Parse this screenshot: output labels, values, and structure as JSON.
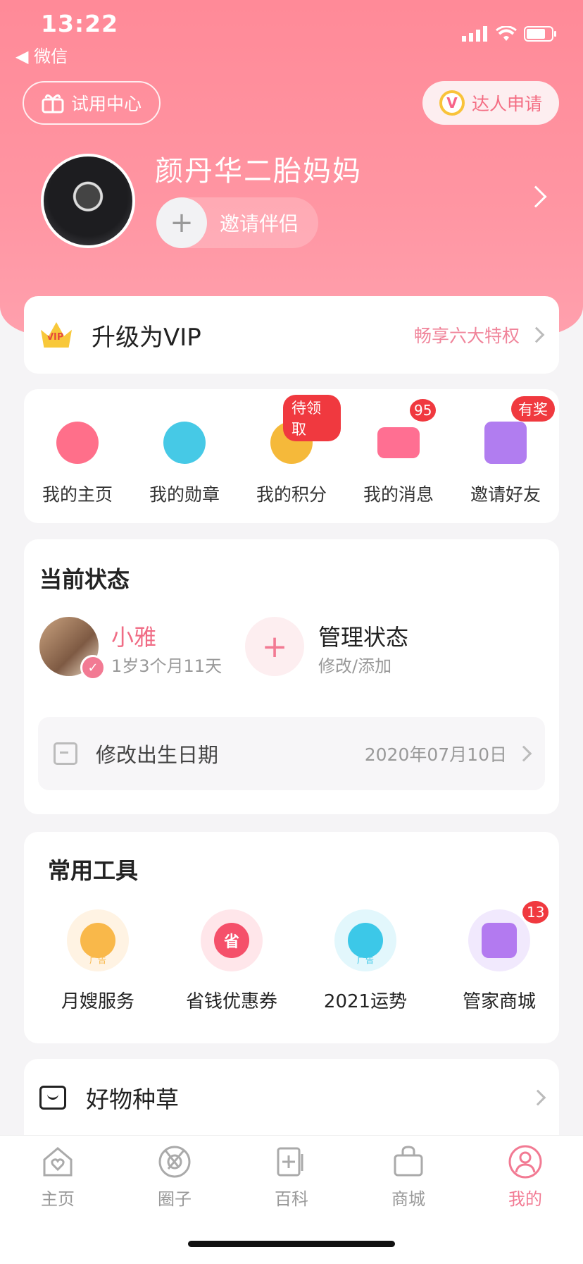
{
  "status_bar": {
    "time": "13:22",
    "back_app": "◀ 微信"
  },
  "header": {
    "trial_label": "试用中心",
    "talent_badge": "V",
    "talent_label": "达人申请",
    "username": "颜丹华二胎妈妈",
    "invite_label": "邀请伴侣",
    "invite_plus": "+"
  },
  "vip": {
    "crown_text": "VIP",
    "title": "升级为VIP",
    "right_text": "畅享六大特权"
  },
  "quick": [
    {
      "label": "我的主页",
      "color": "#ff6f8a",
      "badge": ""
    },
    {
      "label": "我的勋章",
      "color": "#46c9e6",
      "badge": ""
    },
    {
      "label": "我的积分",
      "color": "#f5b93a",
      "badge": "待领取"
    },
    {
      "label": "我的消息",
      "color": "#ff6f92",
      "badge": "95"
    },
    {
      "label": "邀请好友",
      "color": "#b17df0",
      "badge": "有奖"
    }
  ],
  "state": {
    "title": "当前状态",
    "kid_name": "小雅",
    "kid_age": "1岁3个月11天",
    "check": "✓",
    "manage_plus": "+",
    "manage_title": "管理状态",
    "manage_sub": "修改/添加",
    "birth_label": "修改出生日期",
    "birth_date": "2020年07月10日"
  },
  "tools": {
    "title": "常用工具",
    "items": [
      {
        "label": "月嫂服务",
        "core": "",
        "ad": "广告",
        "ring": "#fff3e3",
        "core_color": "#f9b84a",
        "badge": ""
      },
      {
        "label": "省钱优惠券",
        "core": "省",
        "ad": "",
        "ring": "#ffe6ea",
        "core_color": "#f5506a",
        "badge": ""
      },
      {
        "label": "2021运势",
        "core": "",
        "ad": "广告",
        "ring": "#e2f7fc",
        "core_color": "#3cc8e8",
        "badge": ""
      },
      {
        "label": "管家商城",
        "core": "",
        "ad": "",
        "ring": "#f1e9fd",
        "core_color": "#b37af0",
        "badge": "13"
      }
    ]
  },
  "seed": {
    "title": "好物种草"
  },
  "tabbar": [
    {
      "label": "主页",
      "icon": "home-heart-icon",
      "active": false
    },
    {
      "label": "圈子",
      "icon": "circle-aperture-icon",
      "active": false
    },
    {
      "label": "百科",
      "icon": "encyclopedia-icon",
      "active": false
    },
    {
      "label": "商城",
      "icon": "shopping-bag-icon",
      "active": false
    },
    {
      "label": "我的",
      "icon": "profile-icon",
      "active": true
    }
  ],
  "colors": {
    "brand_pink": "#ff8a98",
    "active_tab": "#f27a93",
    "badge_red": "#f0393f"
  }
}
